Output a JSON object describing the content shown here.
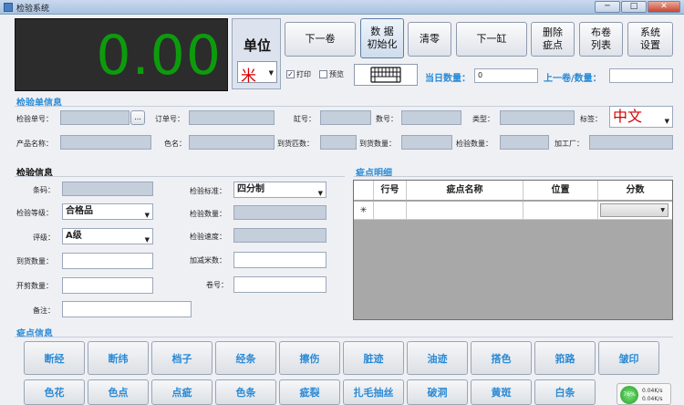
{
  "window": {
    "title": "检验系统",
    "minimize": "─",
    "maximize": "□",
    "close": "✕"
  },
  "display": {
    "value": "0.00"
  },
  "unit": {
    "label": "单位",
    "value": "米"
  },
  "toolbar": {
    "prev_roll": "下一卷",
    "init_data": [
      "数  据",
      "初始化"
    ],
    "clear": "清零",
    "next_tank": "下一缸",
    "delete_defect": [
      "删除",
      "疵点"
    ],
    "roll_list": [
      "布卷",
      "列表"
    ],
    "settings": [
      "系统",
      "设置"
    ]
  },
  "options": {
    "print": "打印",
    "preview": "预览",
    "print_checked": true,
    "preview_checked": false
  },
  "counts": {
    "today_label": "当日数量：",
    "today_value": "0",
    "last_roll_label": "上一卷/数量：",
    "last_roll_value": ""
  },
  "order_section": {
    "title": "检验单信息",
    "order_no_label": "检验单号：",
    "order_no_button": "...",
    "po_label": "订单号：",
    "tank_label": "缸号：",
    "count_label": "数号：",
    "type_label": "类型：",
    "tag_label": "标签：",
    "tag_value": "中文",
    "product_label": "产品名称：",
    "color_label": "色名：",
    "arrive_count_label": "到货匹数：",
    "arrive_qty_label": "到货数量：",
    "inspect_qty_label": "检验数量：",
    "factory_label": "加工厂："
  },
  "inspect_section": {
    "title": "检验信息",
    "code_label": "条码：",
    "grade_label": "检验等级：",
    "grade_value": "合格品",
    "rating_label": "评级：",
    "rating_value": "A级",
    "arrive_qty_label": "到货数量：",
    "cut_qty_label": "开剪数量：",
    "remark_label": "备注：",
    "standard_label": "检验标准：",
    "standard_value": "四分制",
    "inspect_qty_label": "检验数量：",
    "speed_label": "检验速度：",
    "add_meters_label": "加减米数：",
    "roll_no_label": "卷号："
  },
  "defect_detail": {
    "title": "疵点明细",
    "columns": [
      "行号",
      "疵点名称",
      "位置",
      "分数"
    ],
    "new_row_marker": "✳"
  },
  "defect_info": {
    "title": "疵点信息",
    "buttons_row1": [
      "断经",
      "断纬",
      "档子",
      "经条",
      "擦伤",
      "脏迹",
      "油迹",
      "搭色",
      "筘路",
      "皱印"
    ],
    "buttons_row2": [
      "色花",
      "色点",
      "点疵",
      "色条",
      "疵裂",
      "扎毛抽丝",
      "破洞",
      "黄斑",
      "白条"
    ]
  },
  "network": {
    "percent": "76%",
    "up": "0.04K/s",
    "down": "0.04K/s"
  }
}
